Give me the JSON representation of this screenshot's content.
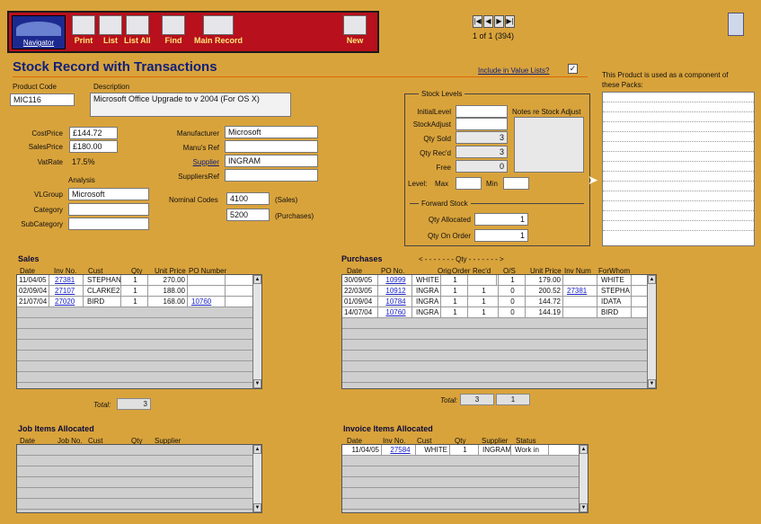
{
  "toolbar": {
    "navigator": "Navigator",
    "print": "Print",
    "list": "List",
    "list_all": "List All",
    "find": "Find",
    "main_record": "Main Record",
    "new": "New"
  },
  "pager": {
    "status": "1 of 1 (394)"
  },
  "page_title": "Stock Record with Transactions",
  "include_label": "Include in Value Lists?",
  "include_checked": "✓",
  "product": {
    "code_label": "Product Code",
    "code": "MIC116",
    "desc_label": "Description",
    "desc": "Microsoft Office Upgrade to v 2004  (For OS X)"
  },
  "pricing": {
    "cost_label": "CostPrice",
    "cost": "£144.72",
    "sales_label": "SalesPrice",
    "sales": "£180.00",
    "vat_label": "VatRate",
    "vat": "17.5%"
  },
  "analysis": {
    "heading": "Analysis",
    "vl_label": "VLGroup",
    "vl": "Microsoft",
    "cat_label": "Category",
    "cat": "",
    "sub_label": "SubCategory",
    "sub": ""
  },
  "supplier": {
    "man_label": "Manufacturer",
    "man": "Microsoft",
    "manref_label": "Manu's Ref",
    "manref": "",
    "sup_label": "Supplier",
    "sup": "INGRAM",
    "supref_label": "SuppliersRef",
    "supref": ""
  },
  "nominal": {
    "label": "Nominal Codes",
    "sales_code": "4100",
    "sales_tag": "(Sales)",
    "purch_code": "5200",
    "purch_tag": "(Purchases)"
  },
  "stock": {
    "heading": "Stock Levels",
    "initial_label": "InitialLevel",
    "initial": "",
    "adjust_label": "StockAdjust",
    "adjust": "",
    "sold_label": "Qty Sold",
    "sold": "3",
    "recd_label": "Qty Rec'd",
    "recd": "3",
    "free_label": "Free",
    "free": "0",
    "level_label": "Level:",
    "max_label": "Max",
    "min_label": "Min",
    "notes_label": "Notes re Stock Adjust",
    "forward_heading": "Forward Stock",
    "alloc_label": "Qty Allocated",
    "alloc": "1",
    "order_label": "Qty On Order",
    "order": "1"
  },
  "packs": {
    "heading": "This Product is used as a component of these Packs:"
  },
  "sales": {
    "heading": "Sales",
    "cols": [
      "Date",
      "Inv No.",
      "Cust",
      "Qty",
      "Unit  Price",
      "PO Number"
    ],
    "rows": [
      [
        "11/04/05",
        "27381",
        "STEPHAN",
        "1",
        "270.00",
        ""
      ],
      [
        "02/09/04",
        "27107",
        "CLARKE2",
        "1",
        "188.00",
        ""
      ],
      [
        "21/07/04",
        "27020",
        "BIRD",
        "1",
        "168.00",
        "10760"
      ]
    ],
    "total_label": "Total:",
    "total": "3"
  },
  "purchases": {
    "heading": "Purchases",
    "qty_banner": "< - - - - - - -  Qty  - - - - - - - >",
    "cols": [
      "Date",
      "PO No.",
      "",
      "Orig",
      "Order",
      "Rec'd",
      "O/S",
      "Unit  Price",
      "Inv Num",
      "ForWhom"
    ],
    "rows": [
      [
        "30/09/05",
        "10999",
        "WHITE",
        "1",
        "",
        "",
        "1",
        "179.00",
        "",
        "WHITE"
      ],
      [
        "22/03/05",
        "10912",
        "INGRA",
        "1",
        "",
        "1",
        "0",
        "200.52",
        "27381",
        "STEPHA"
      ],
      [
        "01/09/04",
        "10784",
        "INGRA",
        "1",
        "",
        "1",
        "0",
        "144.72",
        "",
        "IDATA"
      ],
      [
        "14/07/04",
        "10760",
        "INGRA",
        "1",
        "",
        "1",
        "0",
        "144.19",
        "",
        "BIRD"
      ]
    ],
    "total_label": "Total:",
    "total_order": "3",
    "total_recd": "1"
  },
  "jobs": {
    "heading": "Job Items Allocated",
    "cols": [
      "Date",
      "Job No.",
      "Cust",
      "Qty",
      "Supplier"
    ]
  },
  "invoice": {
    "heading": "Invoice Items Allocated",
    "cols": [
      "Date",
      "Inv No.",
      "Cust",
      "Qty",
      "Supplier",
      "Status"
    ],
    "rows": [
      [
        "11/04/05",
        "27584",
        "WHITE",
        "1",
        "INGRAM",
        "Work in"
      ]
    ]
  }
}
